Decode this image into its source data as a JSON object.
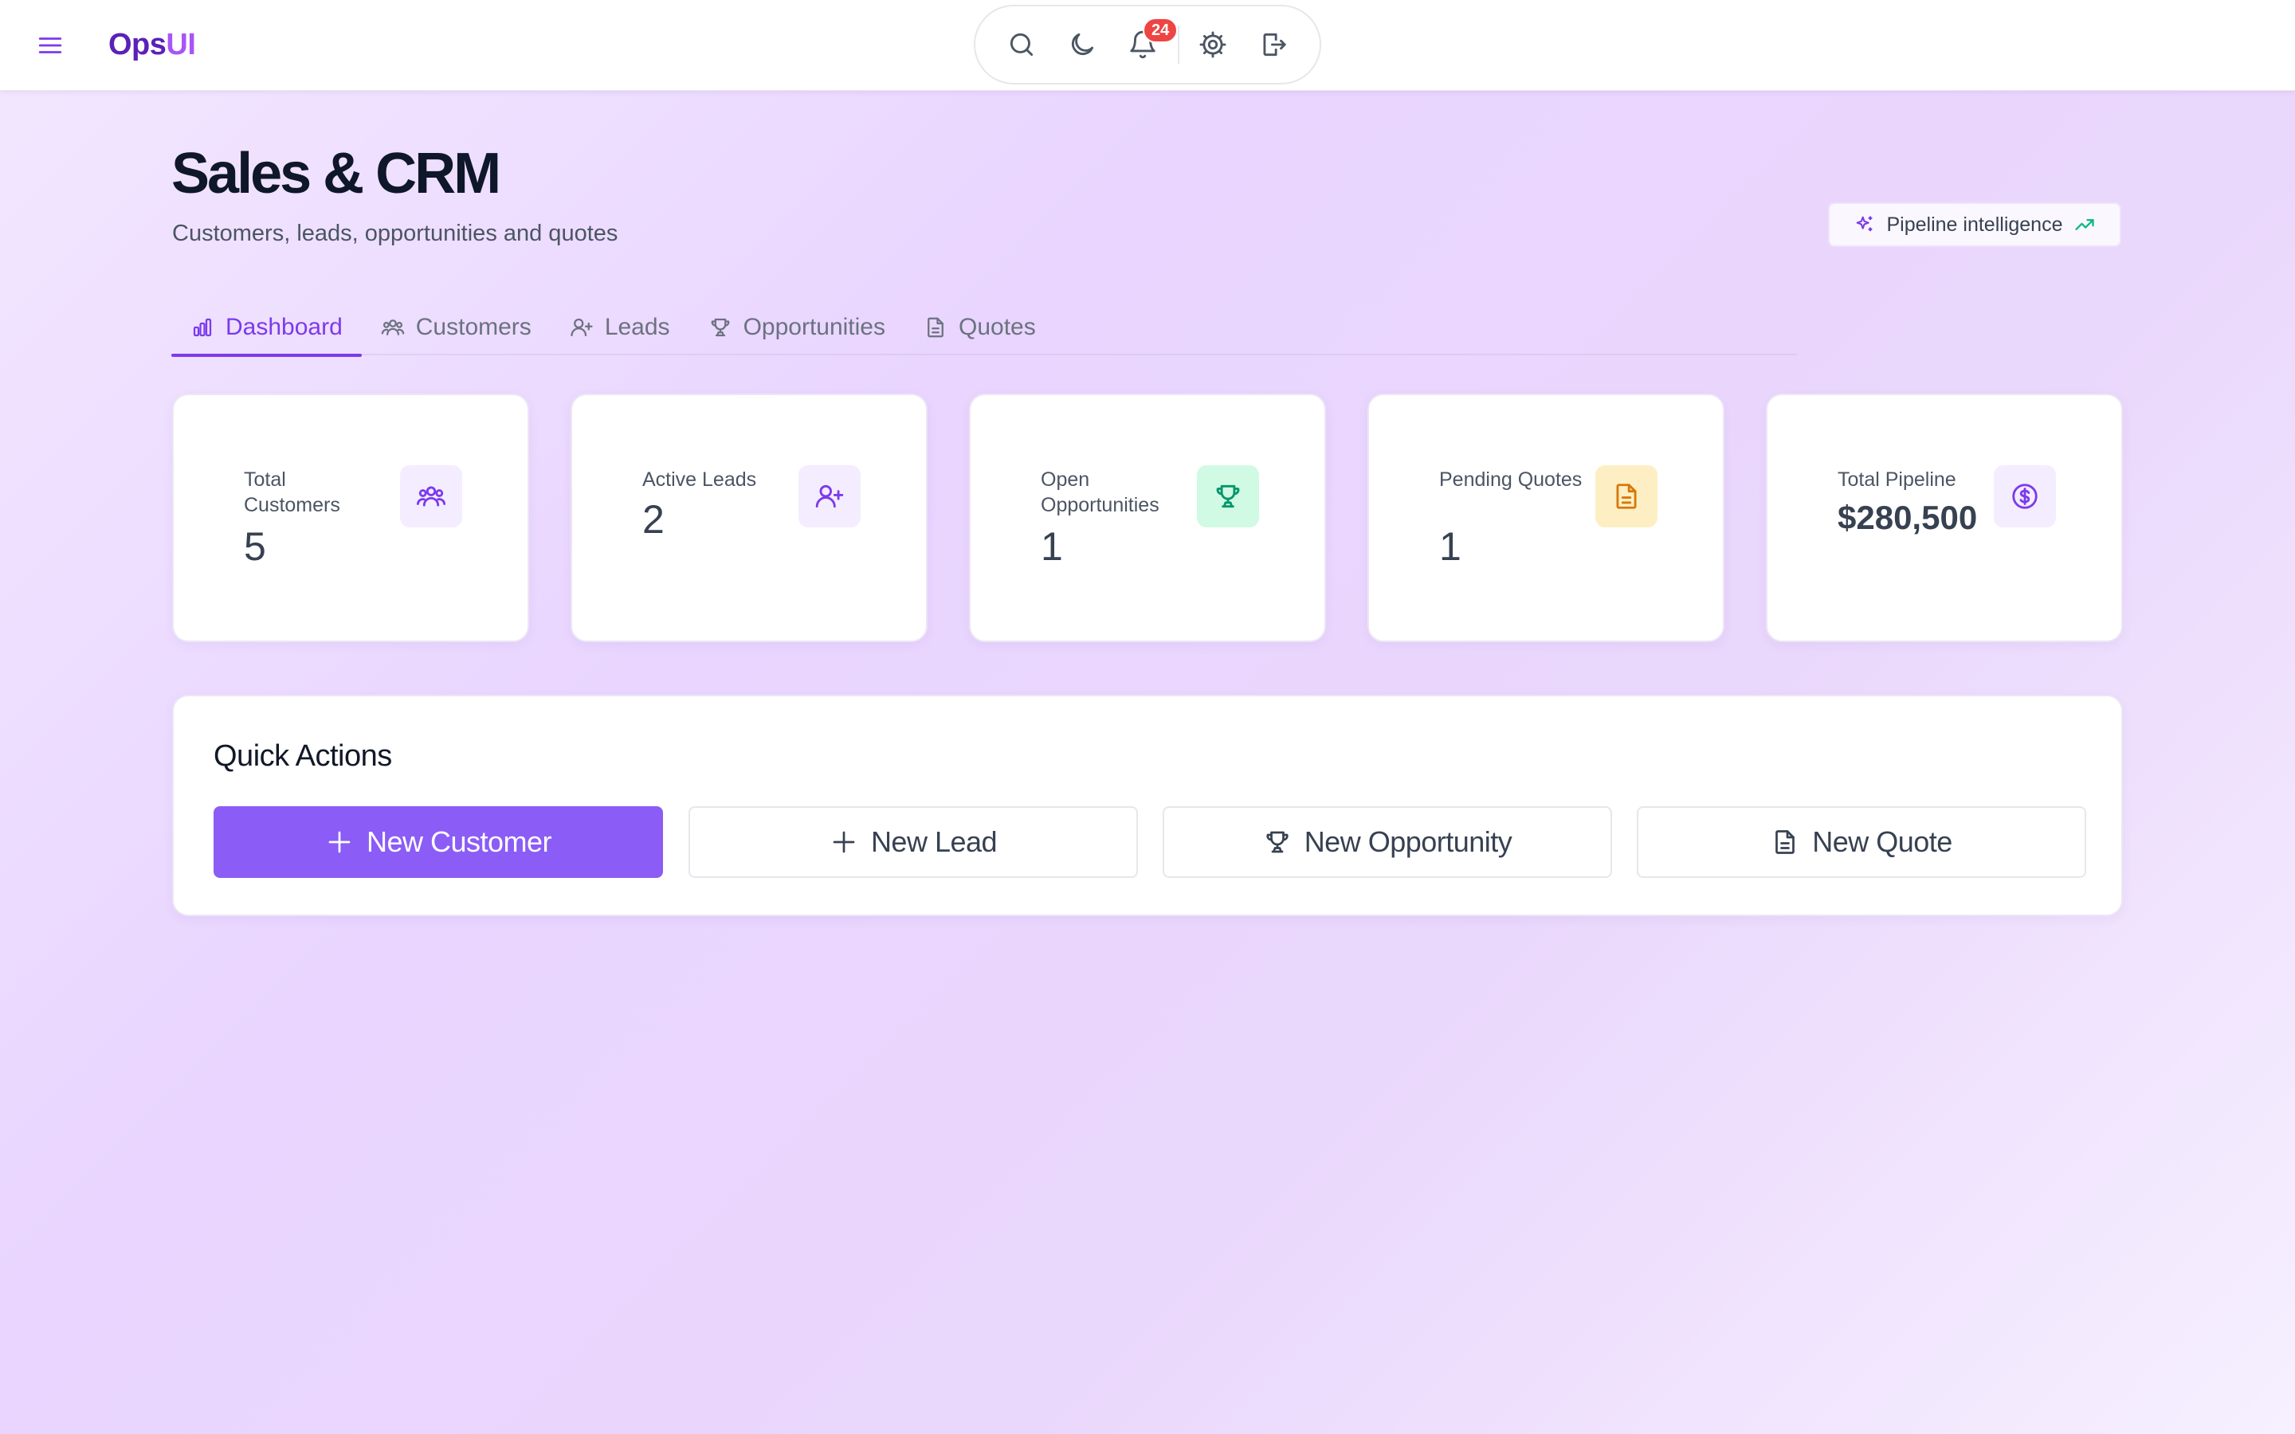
{
  "topbar": {
    "menu_icon": "hamburger-icon",
    "brand_part1": "Ops",
    "brand_part2": "UI",
    "tools": [
      {
        "name": "search-icon"
      },
      {
        "name": "moon-icon"
      },
      {
        "name": "bell-icon",
        "badge": "24"
      },
      {
        "name": "gear-icon"
      },
      {
        "name": "logout-icon"
      }
    ],
    "notification_count": "24"
  },
  "header": {
    "title": "Sales & CRM",
    "subtitle": "Customers, leads, opportunities and quotes",
    "pipeline_button": "Pipeline intelligence"
  },
  "tabs": [
    {
      "label": "Dashboard",
      "icon": "bar-chart-icon",
      "active": true
    },
    {
      "label": "Customers",
      "icon": "users-icon",
      "active": false
    },
    {
      "label": "Leads",
      "icon": "user-plus-icon",
      "active": false
    },
    {
      "label": "Opportunities",
      "icon": "trophy-icon",
      "active": false
    },
    {
      "label": "Quotes",
      "icon": "document-icon",
      "active": false
    }
  ],
  "stats": [
    {
      "label": "Total Customers",
      "value": "5",
      "icon": "users-icon",
      "color": "#7c3aed",
      "bg": "#f3edff"
    },
    {
      "label": "Active Leads",
      "value": "2",
      "icon": "user-plus-icon",
      "color": "#7c3aed",
      "bg": "#f3edff"
    },
    {
      "label": "Open Opportunities",
      "value": "1",
      "icon": "trophy-icon",
      "color": "#059669",
      "bg": "#d1fae5"
    },
    {
      "label": "Pending Quotes",
      "value": "1",
      "icon": "document-icon",
      "color": "#d97706",
      "bg": "#fdefc3"
    },
    {
      "label": "Total Pipeline",
      "value": "$280,500",
      "icon": "dollar-icon",
      "color": "#7c3aed",
      "bg": "#f3edff"
    }
  ],
  "quick_actions": {
    "title": "Quick Actions",
    "buttons": [
      {
        "label": "New Customer",
        "icon": "plus-icon",
        "primary": true
      },
      {
        "label": "New Lead",
        "icon": "plus-icon",
        "primary": false
      },
      {
        "label": "New Opportunity",
        "icon": "trophy-icon",
        "primary": false
      },
      {
        "label": "New Quote",
        "icon": "document-icon",
        "primary": false
      }
    ]
  },
  "colors": {
    "accent": "#7c3aed",
    "primary_button": "#8b5cf6",
    "badge": "#ef4444",
    "trend_green": "#10b981"
  }
}
